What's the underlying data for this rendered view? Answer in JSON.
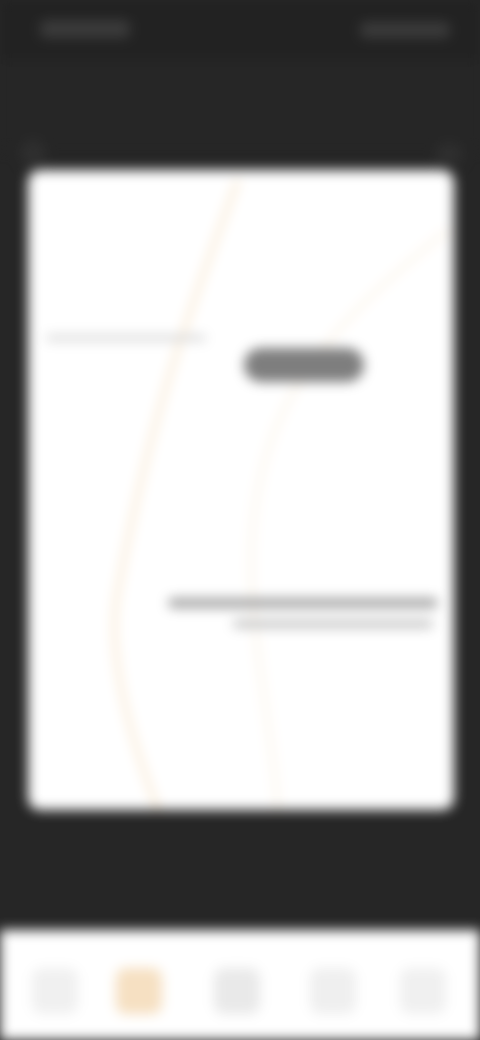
{
  "status": {
    "time": "",
    "icons": ""
  },
  "header": {
    "title": "",
    "back_icon": "back-icon",
    "menu_icon": "menu-icon"
  },
  "preview": {
    "title": "",
    "left_text": "",
    "subtitle_1": "",
    "subtitle_2": ""
  },
  "bottom_nav": [
    {
      "label": ""
    },
    {
      "label": "",
      "active": true,
      "accent": "#E9A24A"
    },
    {
      "label": ""
    },
    {
      "label": ""
    },
    {
      "label": ""
    }
  ],
  "colors": {
    "background": "#262626",
    "card": "#FFFFFF",
    "accent": "#E9A24A"
  }
}
